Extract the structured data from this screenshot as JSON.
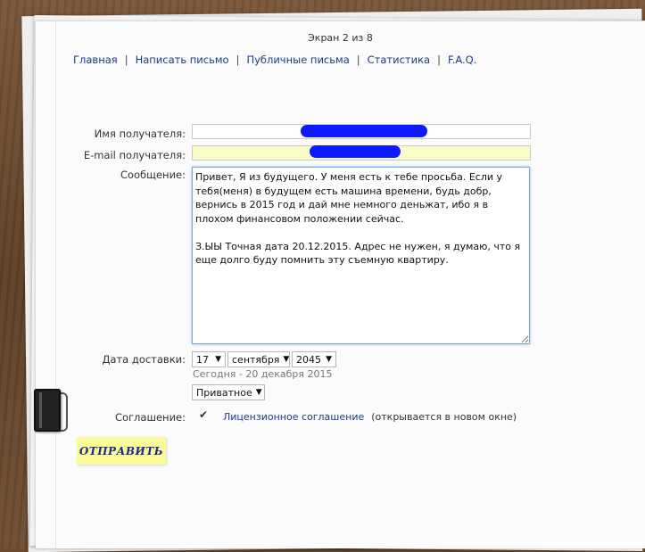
{
  "header": {
    "screen_counter": "Экран 2 из 8"
  },
  "nav": {
    "items": [
      "Главная",
      "Написать письмо",
      "Публичные письма",
      "Статистика",
      "F.A.Q."
    ],
    "separator": "|"
  },
  "form": {
    "recipient_name_label": "Имя получателя:",
    "recipient_email_label": "E-mail получателя:",
    "message_label": "Сообщение:",
    "message_value": "Привет, Я из будущего. У меня есть к тебе просьба. Если у тебя(меня) в будущем есть машина времени, будь добр, вернись в 2015 год и дай мне немного деньжат, ибо я в плохом финансовом положении сейчас.\n\nЗ.ЫЫ Точная дата 20.12.2015. Адрес не нужен, я думаю, что я еще долго буду помнить эту съемную квартиру.",
    "delivery_date_label": "Дата доставки:",
    "day": "17",
    "month": "сентября",
    "year": "2045",
    "today_note": "Сегодня - 20 декабря 2015",
    "privacy": "Приватное",
    "agreement_label": "Соглашение:",
    "agreement_checked": true,
    "license_link": "Лицензионное соглашение",
    "license_note": "(открывается в новом окне)",
    "submit": "ОТПРАВИТЬ"
  },
  "colors": {
    "link": "#1a3a8a",
    "email_field_bg": "#fafcc8",
    "submit_bg": "#fbfb9a",
    "redaction": "#0d1aff"
  }
}
